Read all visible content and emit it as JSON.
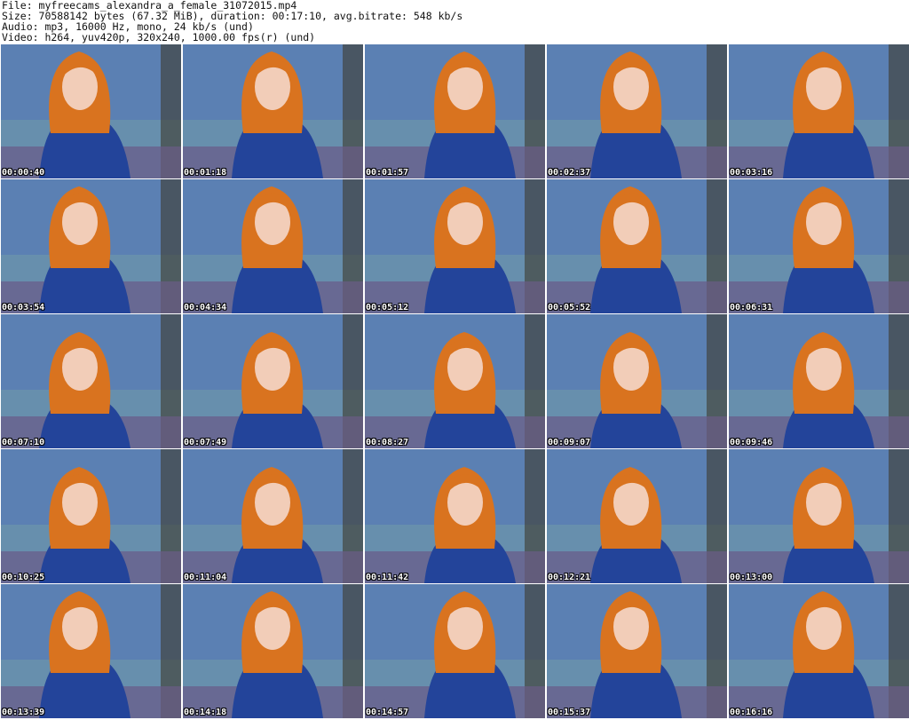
{
  "header": {
    "file_line": "File: myfreecams_alexandra_a_female_31072015.mp4",
    "size_line": "Size: 70588142 bytes (67.32 MiB), duration: 00:17:10, avg.bitrate: 548 kb/s",
    "audio_line": "Audio: mp3, 16000 Hz, mono, 24 kb/s (und)",
    "video_line": "Video: h264, yuv420p, 320x240, 1000.00 fps(r) (und)"
  },
  "thumbnails": [
    "00:00:40",
    "00:01:18",
    "00:01:57",
    "00:02:37",
    "00:03:16",
    "00:03:54",
    "00:04:34",
    "00:05:12",
    "00:05:52",
    "00:06:31",
    "00:07:10",
    "00:07:49",
    "00:08:27",
    "00:09:07",
    "00:09:46",
    "00:10:25",
    "00:11:04",
    "00:11:42",
    "00:12:21",
    "00:13:00",
    "00:13:39",
    "00:14:18",
    "00:14:57",
    "00:15:37",
    "00:16:16"
  ],
  "colors": {
    "background_blue": "#5b80b3",
    "hair": "#d9731f",
    "dress": "#23449a",
    "skin": "#f2cdb8"
  }
}
